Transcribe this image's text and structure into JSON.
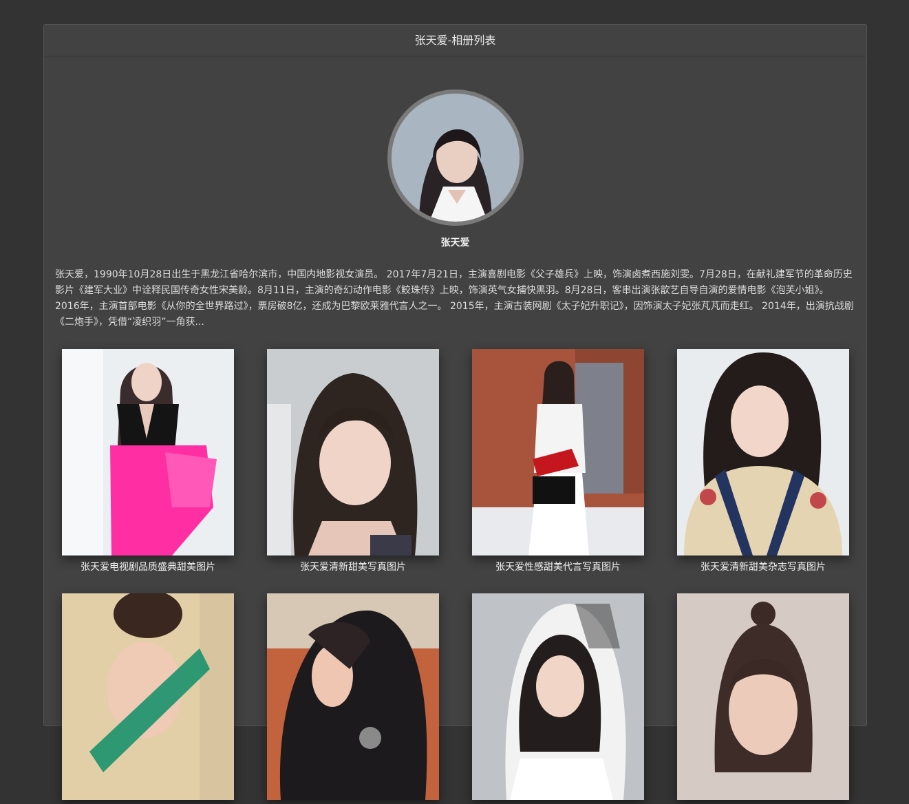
{
  "header": {
    "title": "张天爱-相册列表"
  },
  "profile": {
    "name": "张天爱"
  },
  "bio": "张天爱，1990年10月28日出生于黑龙江省哈尔滨市，中国内地影视女演员。 2017年7月21日，主演喜剧电影《父子雄兵》上映，饰演卤煮西施刘雯。7月28日，在献礼建军节的革命历史影片《建军大业》中诠释民国传奇女性宋美龄。8月11日，主演的奇幻动作电影《鲛珠传》上映，饰演英气女捕快黑羽。8月28日，客串出演张歆艺自导自演的爱情电影《泡芙小姐》。 2016年，主演首部电影《从你的全世界路过》，票房破8亿，还成为巴黎欧莱雅代言人之一。 2015年，主演古装网剧《太子妃升职记》，因饰演太子妃张芃芃而走红。 2014年，出演抗战剧《二炮手》，凭借“凌织羽”一角获...",
  "albums": [
    {
      "caption": "张天爱电视剧品质盛典甜美图片"
    },
    {
      "caption": "张天爱清新甜美写真图片"
    },
    {
      "caption": "张天爱性感甜美代言写真图片"
    },
    {
      "caption": "张天爱清新甜美杂志写真图片"
    },
    {
      "caption": ""
    },
    {
      "caption": ""
    },
    {
      "caption": ""
    },
    {
      "caption": ""
    }
  ]
}
